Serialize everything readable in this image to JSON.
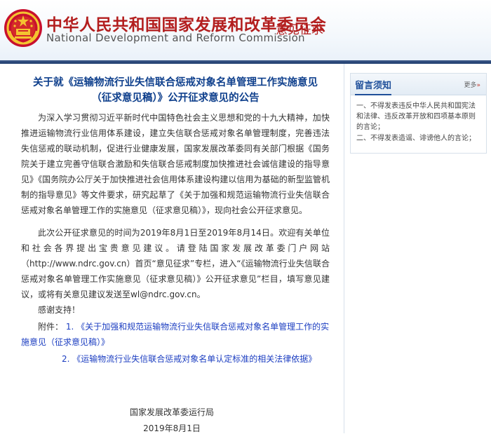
{
  "header": {
    "org_cn": "中华人民共和国国家发展和改革委员会",
    "org_en": "National Development and Reform Commission",
    "section": "意见征求",
    "emblem_icon": "national-emblem-icon",
    "accent_color": "#b31e1e",
    "rule_color": "#1f3c6e"
  },
  "article": {
    "title_line1": "关于就《运输物流行业失信联合惩戒对象名单管理工作实施意见",
    "title_line2": "（征求意见稿）》公开征求意见的公告",
    "para1": "为深入学习贯彻习近平新时代中国特色社会主义思想和党的十九大精神，加快推进运输物流行业信用体系建设，建立失信联合惩戒对象名单管理制度，完善违法失信惩戒的联动机制，促进行业健康发展，国家发展改革委同有关部门根据《国务院关于建立完善守信联合激励和失信联合惩戒制度加快推进社会诚信建设的指导意见》《国务院办公厅关于加快推进社会信用体系建设构建以信用为基础的新型监管机制的指导意见》等文件要求，研究起草了《关于加强和规范运输物流行业失信联合惩戒对象名单管理工作的实施意见（征求意见稿）》，现向社会公开征求意见。",
    "para2": "此次公开征求意见的时间为2019年8月1日至2019年8月14日。欢迎有关单位和社会各界提出宝贵意见建议。请登陆国家发展改革委门户网站（http://www.ndrc.gov.cn）首页“意见征求”专栏，进入“《运输物流行业失信联合惩戒对象名单管理工作实施意见（征求意见稿）》公开征求意见”栏目，填写意见建议，或将有关意见建议发送至wl@ndrc.gov.cn。",
    "para3": "感谢支持！",
    "attachments_label": "附件：",
    "attachments": [
      {
        "number": "1.",
        "title": "《关于加强和规范运输物流行业失信联合惩戒对象名单管理工作的实施意见（征求意见稿）》"
      },
      {
        "number": "2.",
        "title": "《运输物流行业失信联合惩戒对象名单认定标准的相关法律依据》"
      }
    ],
    "signature_org": "国家发展改革委运行局",
    "signature_date": "2019年8月1日",
    "title_color": "#0e3f8c",
    "link_color": "#1c3ec1"
  },
  "sidebar": {
    "title": "留言须知",
    "more_label": "更多",
    "more_icon": "double-chevron-right-icon",
    "items": [
      "一、不得发表违反中华人民共和国宪法和法律、违反改革开放和四项基本原则的言论；",
      "二、不得发表造谣、诽谤他人的言论；"
    ]
  }
}
